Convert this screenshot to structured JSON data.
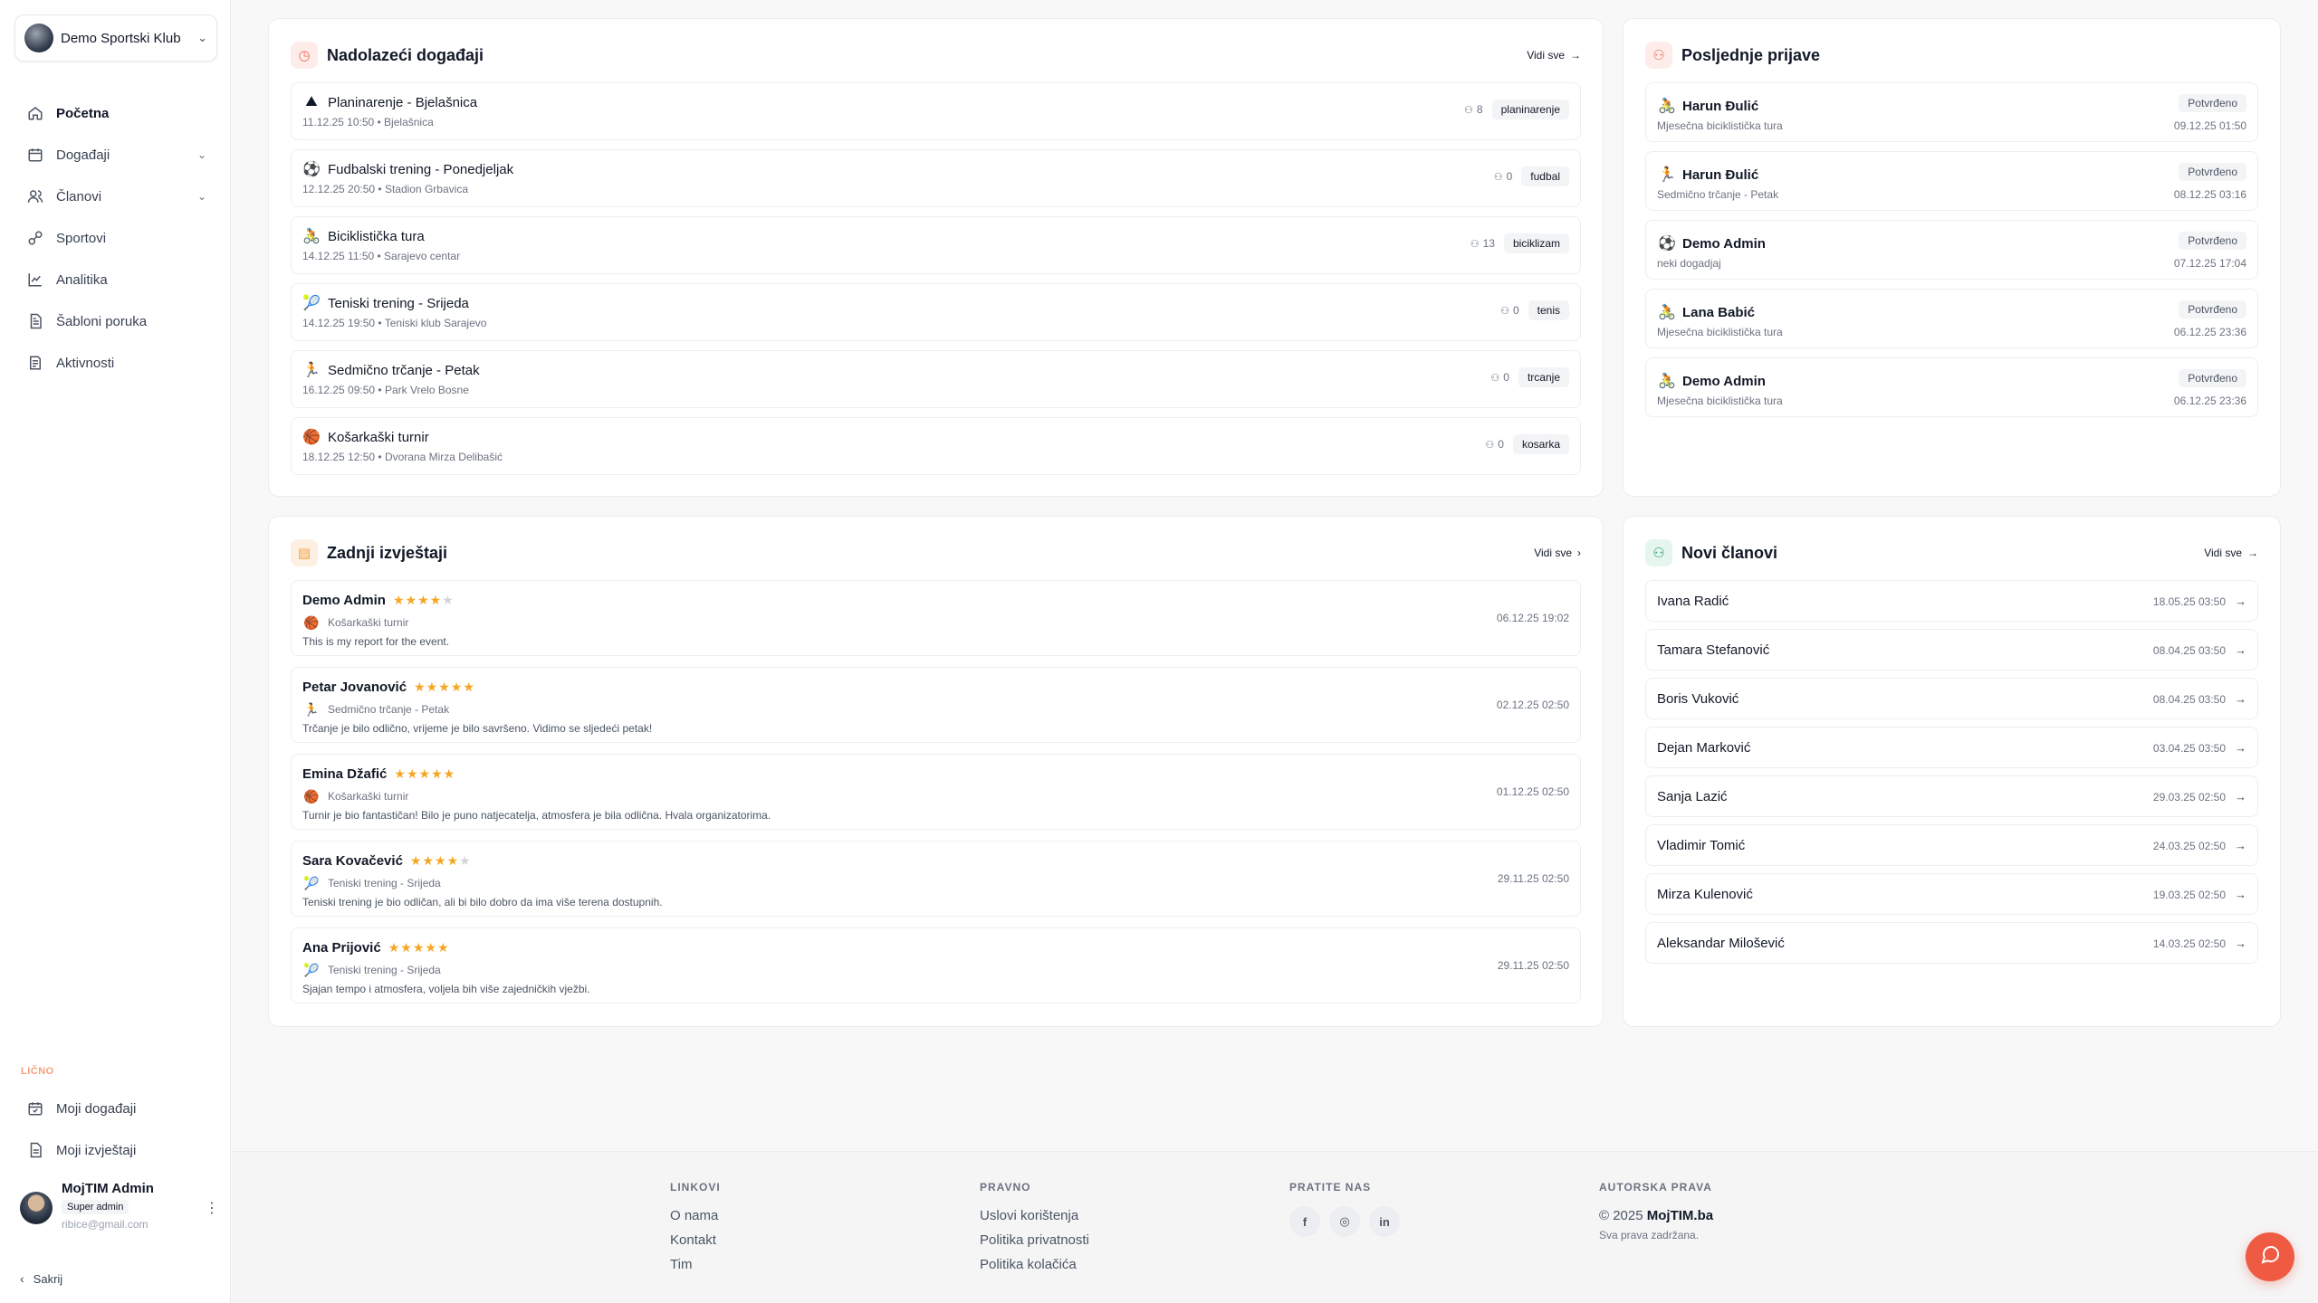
{
  "sidebar": {
    "club_name": "Demo Sportski Klub",
    "nav": [
      {
        "label": "Početna",
        "icon": "home-icon"
      },
      {
        "label": "Događaji",
        "icon": "calendar-icon"
      },
      {
        "label": "Članovi",
        "icon": "users-icon"
      },
      {
        "label": "Sportovi",
        "icon": "sports-icon"
      },
      {
        "label": "Analitika",
        "icon": "chart-icon"
      },
      {
        "label": "Šabloni poruka",
        "icon": "template-icon"
      },
      {
        "label": "Aktivnosti",
        "icon": "activity-icon"
      }
    ],
    "section_label": "LIČNO",
    "personal": [
      {
        "label": "Moji događaji",
        "icon": "calendar-check-icon"
      },
      {
        "label": "Moji izvještaji",
        "icon": "report-icon"
      }
    ],
    "user": {
      "name": "MojTIM Admin",
      "role": "Super admin",
      "email": "ribice@gmail.com"
    },
    "collapse_label": "Sakrij"
  },
  "events_card": {
    "title": "Nadolazeći događaji",
    "view_all": "Vidi sve",
    "items": [
      {
        "title": "Planinarenje - Bjelašnica",
        "meta": "11.12.25 10:50 • Bjelašnica",
        "count": "8",
        "tag": "planinarenje",
        "emoji": "⛰"
      },
      {
        "title": "Fudbalski trening - Ponedjeljak",
        "meta": "12.12.25 20:50 • Stadion Grbavica",
        "count": "0",
        "tag": "fudbal",
        "emoji": "⚽"
      },
      {
        "title": "Biciklistička tura",
        "meta": "14.12.25 11:50 • Sarajevo centar",
        "count": "13",
        "tag": "biciklizam",
        "emoji": "🚴"
      },
      {
        "title": "Teniski trening - Srijeda",
        "meta": "14.12.25 19:50 • Teniski klub Sarajevo",
        "count": "0",
        "tag": "tenis",
        "emoji": "🎾"
      },
      {
        "title": "Sedmično trčanje - Petak",
        "meta": "16.12.25 09:50 • Park Vrelo Bosne",
        "count": "0",
        "tag": "trcanje",
        "emoji": "🏃"
      },
      {
        "title": "Košarkaški turnir",
        "meta": "18.12.25 12:50 • Dvorana Mirza Delibašić",
        "count": "0",
        "tag": "kosarka",
        "emoji": "🏀"
      }
    ]
  },
  "registrations_card": {
    "title": "Posljednje prijave",
    "items": [
      {
        "name": "Harun Đulić",
        "event": "Mjesečna biciklistička tura",
        "status": "Potvrđeno",
        "date": "09.12.25 01:50",
        "emoji": "🚴"
      },
      {
        "name": "Harun Đulić",
        "event": "Sedmično trčanje - Petak",
        "status": "Potvrđeno",
        "date": "08.12.25 03:16",
        "emoji": "🏃"
      },
      {
        "name": "Demo Admin",
        "event": "neki dogadjaj",
        "status": "Potvrđeno",
        "date": "07.12.25 17:04",
        "emoji": "⚽"
      },
      {
        "name": "Lana Babić",
        "event": "Mjesečna biciklistička tura",
        "status": "Potvrđeno",
        "date": "06.12.25 23:36",
        "emoji": "🚴"
      },
      {
        "name": "Demo Admin",
        "event": "Mjesečna biciklistička tura",
        "status": "Potvrđeno",
        "date": "06.12.25 23:36",
        "emoji": "🚴"
      }
    ]
  },
  "reports_card": {
    "title": "Zadnji izvještaji",
    "view_all": "Vidi sve",
    "items": [
      {
        "name": "Demo Admin",
        "rating": 4,
        "event": "Košarkaški turnir",
        "text": "This is my report for the event.",
        "date": "06.12.25 19:02",
        "emoji": "🏀"
      },
      {
        "name": "Petar Jovanović",
        "rating": 5,
        "event": "Sedmično trčanje - Petak",
        "text": "Trčanje je bilo odlično, vrijeme je bilo savršeno. Vidimo se sljedeći petak!",
        "date": "02.12.25 02:50",
        "emoji": "🏃"
      },
      {
        "name": "Emina Džafić",
        "rating": 5,
        "event": "Košarkaški turnir",
        "text": "Turnir je bio fantastičan! Bilo je puno natjecatelja, atmosfera je bila odlična. Hvala organizatorima.",
        "date": "01.12.25 02:50",
        "emoji": "🏀"
      },
      {
        "name": "Sara Kovačević",
        "rating": 4,
        "event": "Teniski trening - Srijeda",
        "text": "Teniski trening je bio odličan, ali bi bilo dobro da ima više terena dostupnih.",
        "date": "29.11.25 02:50",
        "emoji": "🎾"
      },
      {
        "name": "Ana Prijović",
        "rating": 5,
        "event": "Teniski trening - Srijeda",
        "text": "Sjajan tempo i atmosfera, voljela bih više zajedničkih vježbi.",
        "date": "29.11.25 02:50",
        "emoji": "🎾"
      }
    ]
  },
  "members_card": {
    "title": "Novi članovi",
    "view_all": "Vidi sve",
    "items": [
      {
        "name": "Ivana Radić",
        "date": "18.05.25 03:50"
      },
      {
        "name": "Tamara Stefanović",
        "date": "08.04.25 03:50"
      },
      {
        "name": "Boris Vuković",
        "date": "08.04.25 03:50"
      },
      {
        "name": "Dejan Marković",
        "date": "03.04.25 03:50"
      },
      {
        "name": "Sanja Lazić",
        "date": "29.03.25 02:50"
      },
      {
        "name": "Vladimir Tomić",
        "date": "24.03.25 02:50"
      },
      {
        "name": "Mirza Kulenović",
        "date": "19.03.25 02:50"
      },
      {
        "name": "Aleksandar Milošević",
        "date": "14.03.25 02:50"
      }
    ]
  },
  "footer": {
    "links_heading": "LINKOVI",
    "links": [
      "O nama",
      "Kontakt",
      "Tim"
    ],
    "legal_heading": "PRAVNO",
    "legal": [
      "Uslovi korištenja",
      "Politika privatnosti",
      "Politika kolačića"
    ],
    "follow_heading": "PRATITE NAS",
    "social": [
      {
        "icon": "facebook-icon",
        "glyph": "f"
      },
      {
        "icon": "instagram-icon",
        "glyph": "◎"
      },
      {
        "icon": "linkedin-icon",
        "glyph": "in"
      }
    ],
    "copyright_heading": "AUTORSKA PRAVA",
    "copyright_prefix": "© 2025",
    "copyright_brand": "MojTIM.ba",
    "rights": "Sva prava zadržana."
  },
  "colors": {
    "accent": "#ef5a43",
    "star": "#f5a623",
    "section_label": "#f59e7b"
  }
}
